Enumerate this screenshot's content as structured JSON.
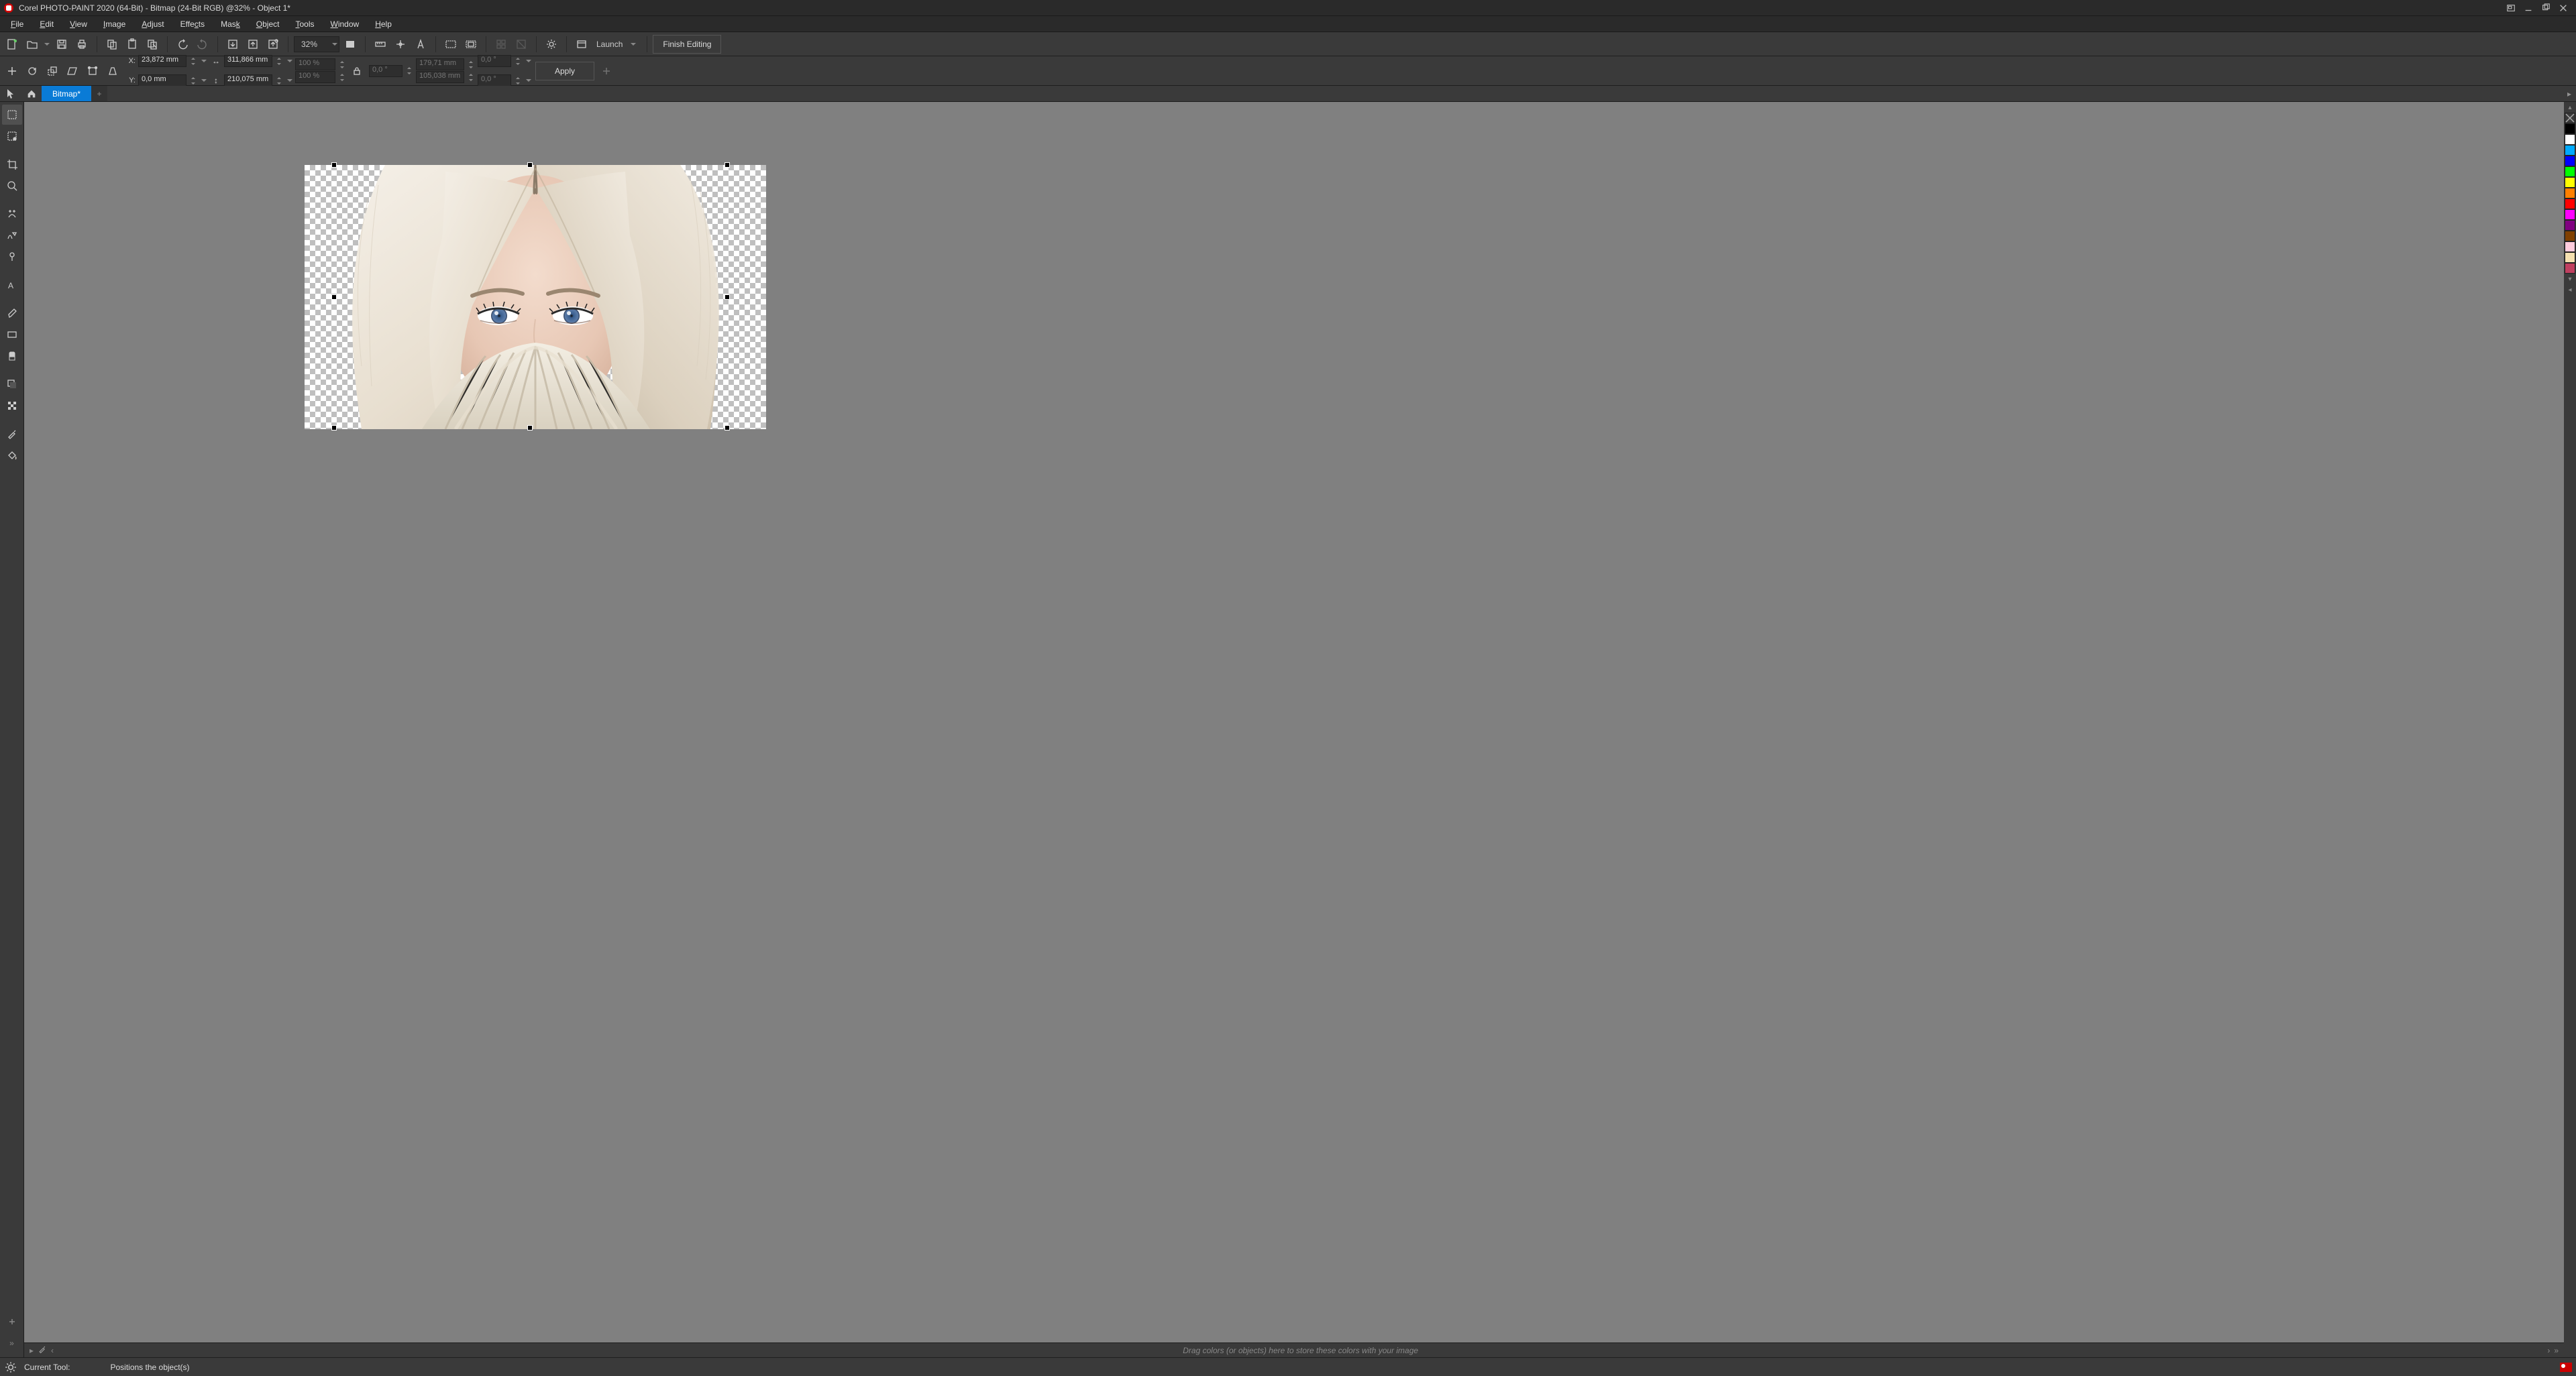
{
  "titlebar": {
    "title": "Corel PHOTO-PAINT 2020 (64-Bit) - Bitmap (24-Bit RGB) @32% - Object 1*"
  },
  "menu": {
    "file": "File",
    "edit": "Edit",
    "view": "View",
    "image": "Image",
    "adjust": "Adjust",
    "effects": "Effects",
    "mask": "Mask",
    "object": "Object",
    "tools": "Tools",
    "window": "Window",
    "help": "Help"
  },
  "toolbar1": {
    "zoom_value": "32%",
    "launch_label": "Launch",
    "finish_label": "Finish Editing"
  },
  "propbar": {
    "x_label": "X:",
    "x_value": "23,872 mm",
    "y_label": "Y:",
    "y_value": "0,0 mm",
    "w_value": "311,866 mm",
    "h_value": "210,075 mm",
    "scale_x": "100 %",
    "scale_y": "100 %",
    "rotation": "0,0 °",
    "cx_value": "179,71 mm",
    "cy_value": "105,038 mm",
    "skew_x": "0,0 °",
    "skew_y": "0,0 °",
    "apply_label": "Apply"
  },
  "tabs": {
    "bitmap_label": "Bitmap*"
  },
  "colortray": {
    "hint": "Drag colors (or objects) here to store these colors with your image"
  },
  "statusbar": {
    "tool_label": "Current Tool:",
    "tool_desc": "Positions the object(s)"
  },
  "palette_colors": [
    "#000000",
    "#ffffff",
    "#00aaff",
    "#0000ff",
    "#00ff00",
    "#ffff00",
    "#ff8000",
    "#ff0000",
    "#ff00ff",
    "#800080",
    "#804000",
    "#ffccdd",
    "#f5e0b0",
    "#c04060"
  ]
}
